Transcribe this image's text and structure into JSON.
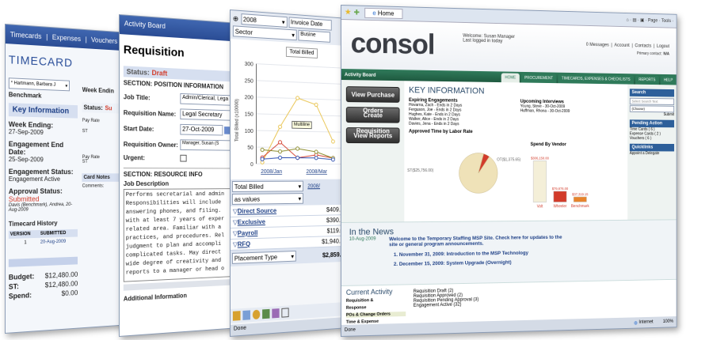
{
  "timecard": {
    "nav": [
      "Timecards",
      "Expenses",
      "Vouchers"
    ],
    "title": "TIMECARD",
    "select_value": "* Hartmann, Barbara J",
    "week_ending_label": "Week Endin",
    "benchmark": "Benchmark",
    "key_info": "Key Information",
    "week_ending": "Week Ending:",
    "week_ending_value": "27-Sep-2009",
    "engagement_end": "Engagement End Date:",
    "engagement_end_value": "25-Sep-2009",
    "engagement_status": "Engagement Status:",
    "engagement_status_value": "Engagement Active",
    "approval_status": "Approval Status:",
    "approval_status_value": "Submitted",
    "approval_by": "Davis (Benchmark), Andrea, 20-Aug-2009",
    "history": "Timecard History",
    "col_version": "VERSION",
    "col_submitted": "SUBMITTED",
    "hist_version": "1",
    "hist_date": "20-Aug-2009",
    "status_label": "Status:",
    "status_value": "Su",
    "pay_rate": "Pay Rate",
    "st": "ST",
    "pay_rate2": "Pay Rate",
    "st2": "ST",
    "card_notes": "Card Notes",
    "comments": "Comments:",
    "budget_label": "Budget:",
    "budget_value": "$12,480.00",
    "st_label": "ST:",
    "st_value": "$12,480.00",
    "spend_label": "Spend:",
    "spend_value": "$0.00"
  },
  "requisition": {
    "nav": "Activity Board",
    "title": "Requisition",
    "status_label": "Status:",
    "status_value": "Draft",
    "section1": "SECTION: POSITION INFORMATION",
    "job_title_label": "Job Title:",
    "job_title_value": "Admin/Clerical, Lega",
    "req_name_label": "Requisition Name:",
    "req_name_value": "Legal Secretary",
    "start_label": "Start Date:",
    "start_value": "27-Oct-2009",
    "owner_label": "Requisition Owner:",
    "owner_value": "Manager, Susan (S",
    "urgent_label": "Urgent:",
    "section2": "SECTION: RESOURCE INFO",
    "job_desc_label": "Job Description",
    "job_desc": [
      "Performs secretarial and admin",
      "Responsibilities will include",
      "answering phones, and filing.",
      "with at least 7 years of exper",
      "related area. Familiar with a",
      "practices, and procedures. Rel",
      "judgment to plan and accompli",
      "complicated tasks. May direct",
      "wide degree of creativity and",
      "reports to a manager or head o"
    ],
    "additional": "Additional Information"
  },
  "analysis": {
    "period": "2008",
    "period2": "Invoice Date",
    "sector": "Sector",
    "business": "Busine",
    "total_billed": "Total Billed",
    "yaxis": "Total Billed (x10000)",
    "yticks": [
      "300",
      "250",
      "200",
      "150",
      "100",
      "50",
      "0"
    ],
    "xticks": [
      "2008/Jan",
      "2008/Mar"
    ],
    "tooltip": "Multiline",
    "pivot_measure": "Total Billed",
    "pivot_mode": "as values",
    "pivot_col": "2008/",
    "rows": [
      {
        "label": "Direct Source",
        "value": "$409.2"
      },
      {
        "label": "Exclusive",
        "value": "$390.7"
      },
      {
        "label": "Payroll",
        "value": "$119.0"
      },
      {
        "label": "RFQ",
        "value": "$1,940.3"
      }
    ],
    "placement": "Placement Type",
    "placement_value": "$2,859.4",
    "status": "Done"
  },
  "consol": {
    "browser_tab": "Home",
    "logo": "consol",
    "welcome": "Welcome: Susan Manager",
    "last_logged": "Last logged in today",
    "messages": "0 Messages",
    "account": "Account",
    "contacts": "Contacts",
    "logout": "Logout",
    "primary_contact": "Primary contact:",
    "primary_value": "N/A",
    "activity_board": "Activity Board",
    "tabs": [
      "HOME",
      "PROCUREMENT",
      "TIMECARDS, EXPENSES & CHECKLISTS",
      "REPORTS",
      "HELP"
    ],
    "buttons": [
      "View Purchase Orders",
      "Create Requisition",
      "View Reports"
    ],
    "key_info": "KEY INFORMATION",
    "expiring": "Expiring Engagements",
    "expiring_list": [
      "Hovarna, Zach - Ends in 2 Days",
      "Ferguson, Joe - Ends in 2 Days",
      "Hughes, Kate - Ends in 2 Days",
      "Walker, Alice - Ends in 2 Days",
      "Davies, Jena - Ends in 2 Days"
    ],
    "interviews": "Upcoming Interviews",
    "interview_list": [
      "Young, Steve - 30-Oct-2009",
      "Huffman, Rhona - 30-Oct-2009"
    ],
    "approved_title": "Approved Time by Labor Rate",
    "pie_st": "ST($25,756.00)",
    "pie_ot": "OT($1,375.65)",
    "pie_data": [
      {
        "label": "ST",
        "value": 25756.0
      },
      {
        "label": "OT",
        "value": 1375.65
      }
    ],
    "spend_title": "Spend By Vendor",
    "spend_labels": [
      "Volt",
      "Wheeler",
      "Benchmark"
    ],
    "spend_values_text": [
      "$306,150.00",
      "$79,876.00",
      "$37,319.15"
    ],
    "spend_values": [
      306150.0,
      79876.0,
      37319.15
    ],
    "search": "Search",
    "search_placeholder": "Select Search Text",
    "search_select": "(Choose)",
    "submit": "Submit",
    "pending": "Pending Action",
    "pending_list": [
      "Time Cards ( 6 )",
      "Expense Cards ( 2 )",
      "Vouchers ( 6 )"
    ],
    "quicklinks": "Quicklinks",
    "quicklink": "Appoint a Delegate",
    "news_title": "In the News",
    "news_date": "10-Aug-2009",
    "news_headline": "Welcome to the Temporary Staffing MSP Site. Check here for updates to the site or general program announcements.",
    "news_items": [
      "1. November 31, 2009: Introduction to the MSP Technology",
      "2. December 15, 2009: System Upgrade (Overnight)"
    ],
    "current_activity": "Current Activity",
    "activity_tabs": [
      "Requisition &",
      "Response",
      "POs & Change Orders",
      "Time & Expense"
    ],
    "activity_list": [
      "Requisition Draft (2)",
      "Requisition Approved (2)",
      "Requisition Pending Approval (3)",
      "Engagement Active (32)"
    ],
    "done": "Done",
    "internet": "Internet",
    "zoom": "100%"
  },
  "colors": {
    "accent": "#2d5f9a",
    "green": "#2f7a5a",
    "red": "#d23b2a",
    "orange": "#e8832a"
  }
}
